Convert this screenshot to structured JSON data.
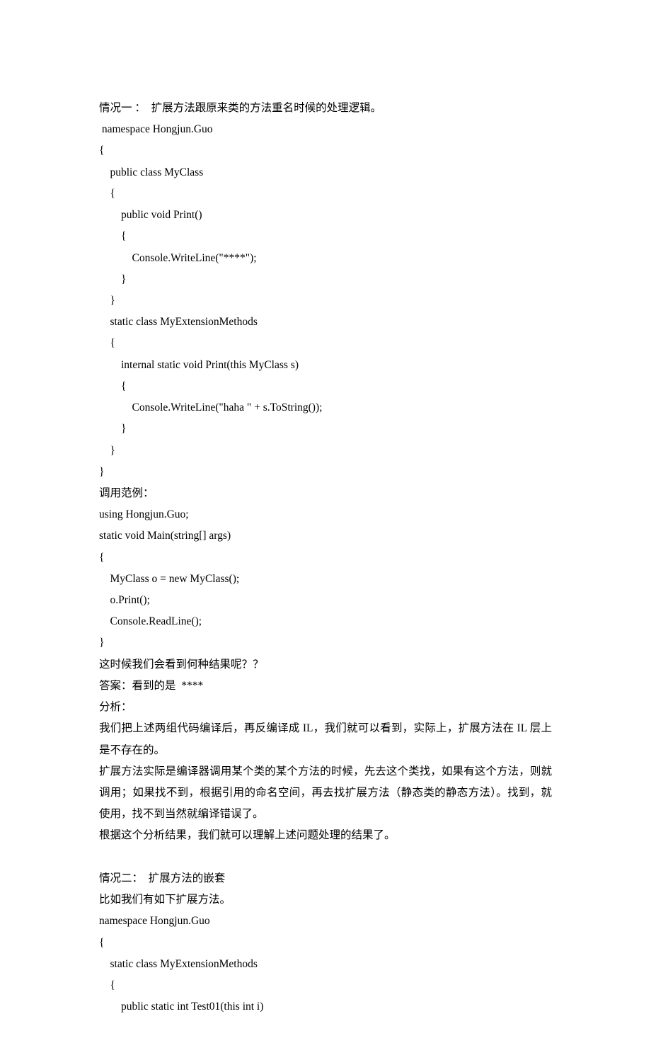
{
  "lines": [
    "情况一 ：  扩展方法跟原来类的方法重名时候的处理逻辑。",
    " namespace Hongjun.Guo",
    "{",
    "    public class MyClass",
    "    {",
    "        public void Print()",
    "        {",
    "            Console.WriteLine(\"****\");",
    "        }",
    "    }",
    "    static class MyExtensionMethods",
    "    {",
    "        internal static void Print(this MyClass s)",
    "        {",
    "            Console.WriteLine(\"haha \" + s.ToString());",
    "        }",
    "    }",
    "}",
    "调用范例：",
    "using Hongjun.Guo;",
    "static void Main(string[] args)",
    "{",
    "    MyClass o = new MyClass();",
    "    o.Print();",
    "    Console.ReadLine();",
    "}",
    "这时候我们会看到何种结果呢？？",
    "答案：看到的是  ****",
    "分析：",
    "我们把上述两组代码编译后，再反编译成 IL，我们就可以看到，实际上，扩展方法在 IL 层上是不存在的。",
    "扩展方法实际是编译器调用某个类的某个方法的时候，先去这个类找，如果有这个方法，则就调用；如果找不到，根据引用的命名空间，再去找扩展方法（静态类的静态方法）。找到，就使用，找不到当然就编译错误了。",
    "根据这个分析结果，我们就可以理解上述问题处理的结果了。",
    "",
    "情况二：  扩展方法的嵌套",
    "比如我们有如下扩展方法。",
    "namespace Hongjun.Guo",
    "{",
    "    static class MyExtensionMethods",
    "    {",
    "        public static int Test01(this int i)"
  ]
}
